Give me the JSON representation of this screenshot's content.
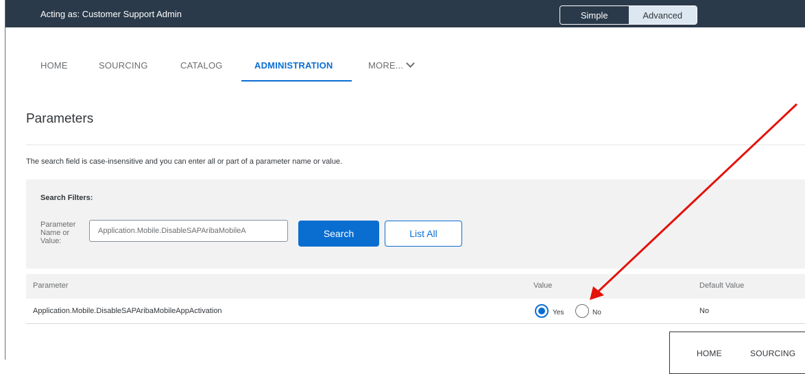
{
  "topbar": {
    "acting_as": "Acting as: Customer Support Admin",
    "mode_simple": "Simple",
    "mode_advanced": "Advanced"
  },
  "nav": {
    "items": [
      "HOME",
      "SOURCING",
      "CATALOG",
      "ADMINISTRATION",
      "MORE..."
    ],
    "active": "ADMINISTRATION"
  },
  "page": {
    "title": "Parameters",
    "help_text": "The search field is case-insensitive and you can enter all or part of a parameter name or value."
  },
  "filters": {
    "title": "Search Filters:",
    "param_label": "Parameter Name or Value:",
    "input_value": "Application.Mobile.DisableSAPAribaMobileA",
    "search_label": "Search",
    "list_all_label": "List All"
  },
  "table": {
    "headers": [
      "Parameter",
      "Value",
      "Default Value"
    ],
    "rows": [
      {
        "parameter": "Application.Mobile.DisableSAPAribaMobileAppActivation",
        "value_options": [
          "Yes",
          "No"
        ],
        "selected": "Yes",
        "default_value": "No"
      }
    ]
  },
  "inset": {
    "items": [
      "HOME",
      "SOURCING"
    ]
  },
  "colors": {
    "topbar": "#2b3a4a",
    "accent": "#0a6ed1",
    "arrow": "#e3120b"
  }
}
